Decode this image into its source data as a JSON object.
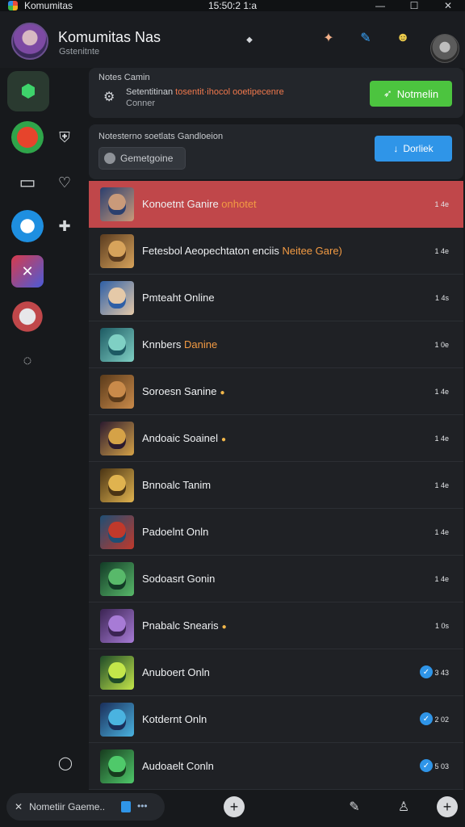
{
  "window": {
    "title": "Komumitas",
    "time": "15:50:2 1:a",
    "minimize": "—",
    "maximize": "☐",
    "close": "✕"
  },
  "header": {
    "server_name": "Komumitas Nas",
    "server_sub": "Gstenitnte"
  },
  "panel_notice": {
    "label": "Notes Camin",
    "line1_prefix": "Setentitinan ",
    "line1_accent": "tosentit·ihocol ooetipecenre",
    "line2": "Conner",
    "button_label": "Notmelin"
  },
  "panel_games": {
    "heading": "Notesterno soetlats Gandloeion",
    "search_value": "Gemetgoine",
    "button_label": "Dorliek"
  },
  "games": [
    {
      "name": "Konoetnt Ganire",
      "highlight": "onhotet",
      "count": "1 4e",
      "active": true,
      "dot": false,
      "check": false
    },
    {
      "name": "Fetesbol Aeopechtaton enciis",
      "highlight": "Neitee Gare)",
      "count": "1 4e",
      "active": false,
      "dot": false,
      "check": false
    },
    {
      "name": "Pmteaht Online",
      "highlight": "",
      "count": "1 4s",
      "active": false,
      "dot": false,
      "check": false
    },
    {
      "name": "Knnbers",
      "highlight": "Danine",
      "count": "1 0e",
      "active": false,
      "dot": false,
      "check": false
    },
    {
      "name": "Soroesn Sanine",
      "highlight": "",
      "count": "1 4e",
      "active": false,
      "dot": true,
      "check": false
    },
    {
      "name": "Andoaic Soainel",
      "highlight": "",
      "count": "1 4e",
      "active": false,
      "dot": true,
      "check": false
    },
    {
      "name": "Bnnoalc Tanim",
      "highlight": "",
      "count": "1 4e",
      "active": false,
      "dot": false,
      "check": false
    },
    {
      "name": "Padoelnt Onln",
      "highlight": "",
      "count": "1 4e",
      "active": false,
      "dot": false,
      "check": false
    },
    {
      "name": "Sodoasrt Gonin",
      "highlight": "",
      "count": "1 4e",
      "active": false,
      "dot": false,
      "check": false
    },
    {
      "name": "Pnabalc Snearis",
      "highlight": "",
      "count": "1 0s",
      "active": false,
      "dot": true,
      "check": false
    },
    {
      "name": "Anuboert Onln",
      "highlight": "",
      "count": "3 43",
      "active": false,
      "dot": false,
      "check": true
    },
    {
      "name": "Kotdernt Onln",
      "highlight": "",
      "count": "2 02",
      "active": false,
      "dot": false,
      "check": true
    },
    {
      "name": "Audoaelt Conln",
      "highlight": "",
      "count": "5 03",
      "active": false,
      "dot": false,
      "check": true
    }
  ],
  "bottom": {
    "chip_label": "Nometiir Gaeme..",
    "chip_dots": "•••"
  },
  "colors": {
    "active_row": "#c0474a",
    "notify_green": "#4cc43f",
    "download_blue": "#2f95e8",
    "accent_orange": "#f29a43"
  }
}
